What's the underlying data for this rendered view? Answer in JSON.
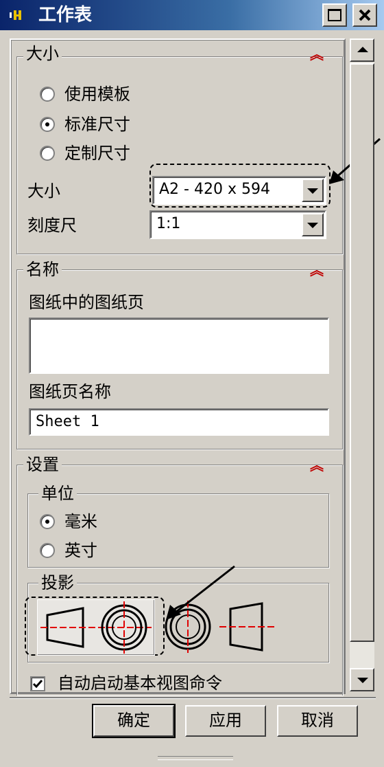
{
  "window": {
    "title": "工作表"
  },
  "size_section": {
    "title": "大小",
    "radios": [
      {
        "label": "使用模板",
        "checked": false
      },
      {
        "label": "标准尺寸",
        "checked": true
      },
      {
        "label": "定制尺寸",
        "checked": false
      }
    ],
    "size_label": "大小",
    "size_value": "A2 - 420 x 594",
    "scale_label": "刻度尺",
    "scale_value": "1:1"
  },
  "name_section": {
    "title": "名称",
    "sheets_label": "图纸中的图纸页",
    "sheet_name_label": "图纸页名称",
    "sheet_name_value": "Sheet 1"
  },
  "settings_section": {
    "title": "设置",
    "units": {
      "title": "单位",
      "radios": [
        {
          "label": "毫米",
          "checked": true
        },
        {
          "label": "英寸",
          "checked": false
        }
      ]
    },
    "projection": {
      "title": "投影"
    },
    "auto_start_label": "自动启动基本视图命令",
    "auto_start_checked": true
  },
  "buttons": {
    "ok": "确定",
    "apply": "应用",
    "cancel": "取消"
  },
  "colors": {
    "accent_red": "#c00000",
    "title_blue": "#0a246a"
  }
}
